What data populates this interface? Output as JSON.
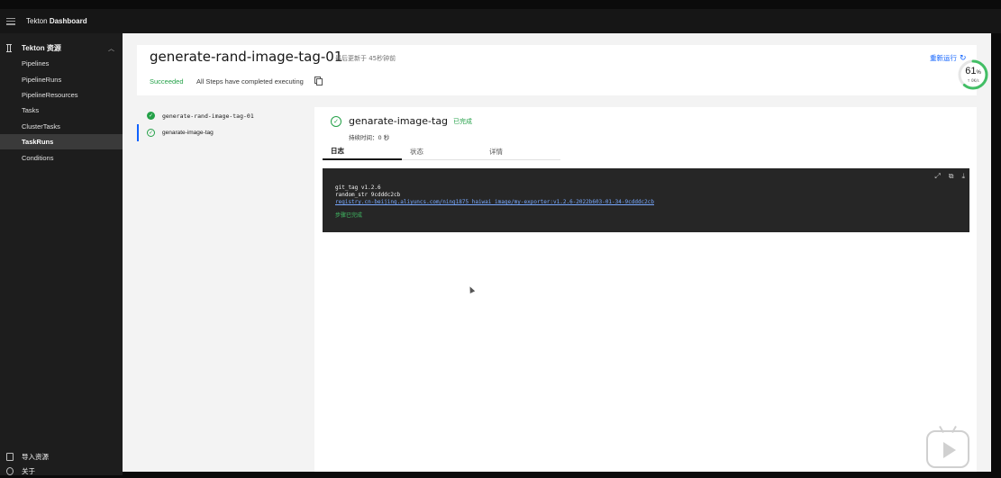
{
  "app": {
    "title_prefix": "Tekton",
    "title_bold": "Dashboard"
  },
  "sidebar": {
    "section_label": "Tekton 资源",
    "items": [
      {
        "label": "Pipelines",
        "active": false
      },
      {
        "label": "PipelineRuns",
        "active": false
      },
      {
        "label": "PipelineResources",
        "active": false
      },
      {
        "label": "Tasks",
        "active": false
      },
      {
        "label": "ClusterTasks",
        "active": false
      },
      {
        "label": "TaskRuns",
        "active": true
      },
      {
        "label": "Conditions",
        "active": false
      }
    ],
    "bottom": [
      {
        "label": "导入资源",
        "icon": "import-icon"
      },
      {
        "label": "关于",
        "icon": "info-icon"
      }
    ]
  },
  "pipeline_run": {
    "name": "generate-rand-image-tag-01",
    "updated": "最后更新于 45秒钟前",
    "status": "Succeeded",
    "message": "All Steps have completed executing",
    "rerun_label": "重新运行"
  },
  "progress": {
    "percent": 61,
    "label": "61",
    "unit": "%",
    "sub": "↑ 0K/s"
  },
  "task_list": [
    {
      "label": "generate-rand-image-tag-01",
      "kind": "task"
    },
    {
      "label": "genarate-image-tag",
      "kind": "step"
    }
  ],
  "step": {
    "name": "genarate-image-tag",
    "status": "已完成",
    "duration": "持续时间：0 秒",
    "tabs": [
      "日志",
      "状态",
      "详情"
    ],
    "active_tab": 0
  },
  "log": {
    "lines": [
      "git_tag v1.2.6",
      "random_str 9cdddc2cb"
    ],
    "link": "registry.cn-beijing.aliyuncs.com/ning1875_haiwai_image/my-exporter:v1.2.6-2022b603-01-34-9cdddc2cb",
    "done": "步骤已完成"
  },
  "colors": {
    "success": "#24a148",
    "link": "#0f62fe",
    "sidebar": "#1d1d1d",
    "log_bg": "#262626"
  }
}
